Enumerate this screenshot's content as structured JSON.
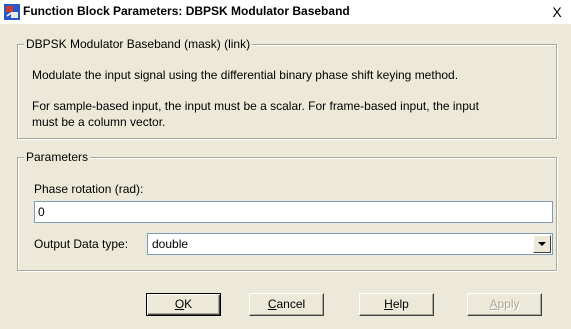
{
  "window": {
    "title": "Function Block Parameters: DBPSK Modulator Baseband",
    "close_glyph": "X"
  },
  "description": {
    "group_label": "DBPSK Modulator Baseband (mask) (link)",
    "line1": "Modulate the input signal using the differential binary phase shift keying method.",
    "line2": "For sample-based input, the input must be a scalar. For frame-based input, the input",
    "line3": "must be a column vector."
  },
  "parameters": {
    "group_label": "Parameters",
    "phase_rotation_label": "Phase rotation (rad):",
    "phase_rotation_value": "0",
    "output_type_label": "Output Data type:",
    "output_type_value": "double"
  },
  "buttons": {
    "ok": {
      "mnemonic": "O",
      "rest": "K"
    },
    "cancel": {
      "mnemonic": "C",
      "rest": "ancel"
    },
    "help": {
      "mnemonic": "H",
      "rest": "elp"
    },
    "apply": {
      "mnemonic": "A",
      "rest": "pply"
    }
  },
  "colors": {
    "dialog_bg": "#ece9d8",
    "icon_red": "#d03a2a",
    "icon_blue": "#2a57c8"
  }
}
